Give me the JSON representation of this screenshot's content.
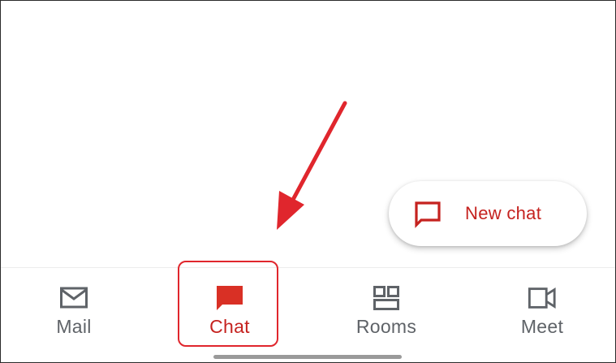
{
  "fab": {
    "label": "New chat",
    "icon": "chat-outline-icon"
  },
  "nav": {
    "items": [
      {
        "label": "Mail",
        "icon": "mail-icon",
        "active": false
      },
      {
        "label": "Chat",
        "icon": "chat-icon",
        "active": true
      },
      {
        "label": "Rooms",
        "icon": "rooms-icon",
        "active": false
      },
      {
        "label": "Meet",
        "icon": "meet-icon",
        "active": false
      }
    ]
  },
  "annotation": {
    "type": "arrow-and-box",
    "target": "Chat",
    "color": "#e0262d"
  },
  "colors": {
    "accent": "#c5221f",
    "inactive": "#5f6368",
    "annotation": "#e0262d"
  }
}
